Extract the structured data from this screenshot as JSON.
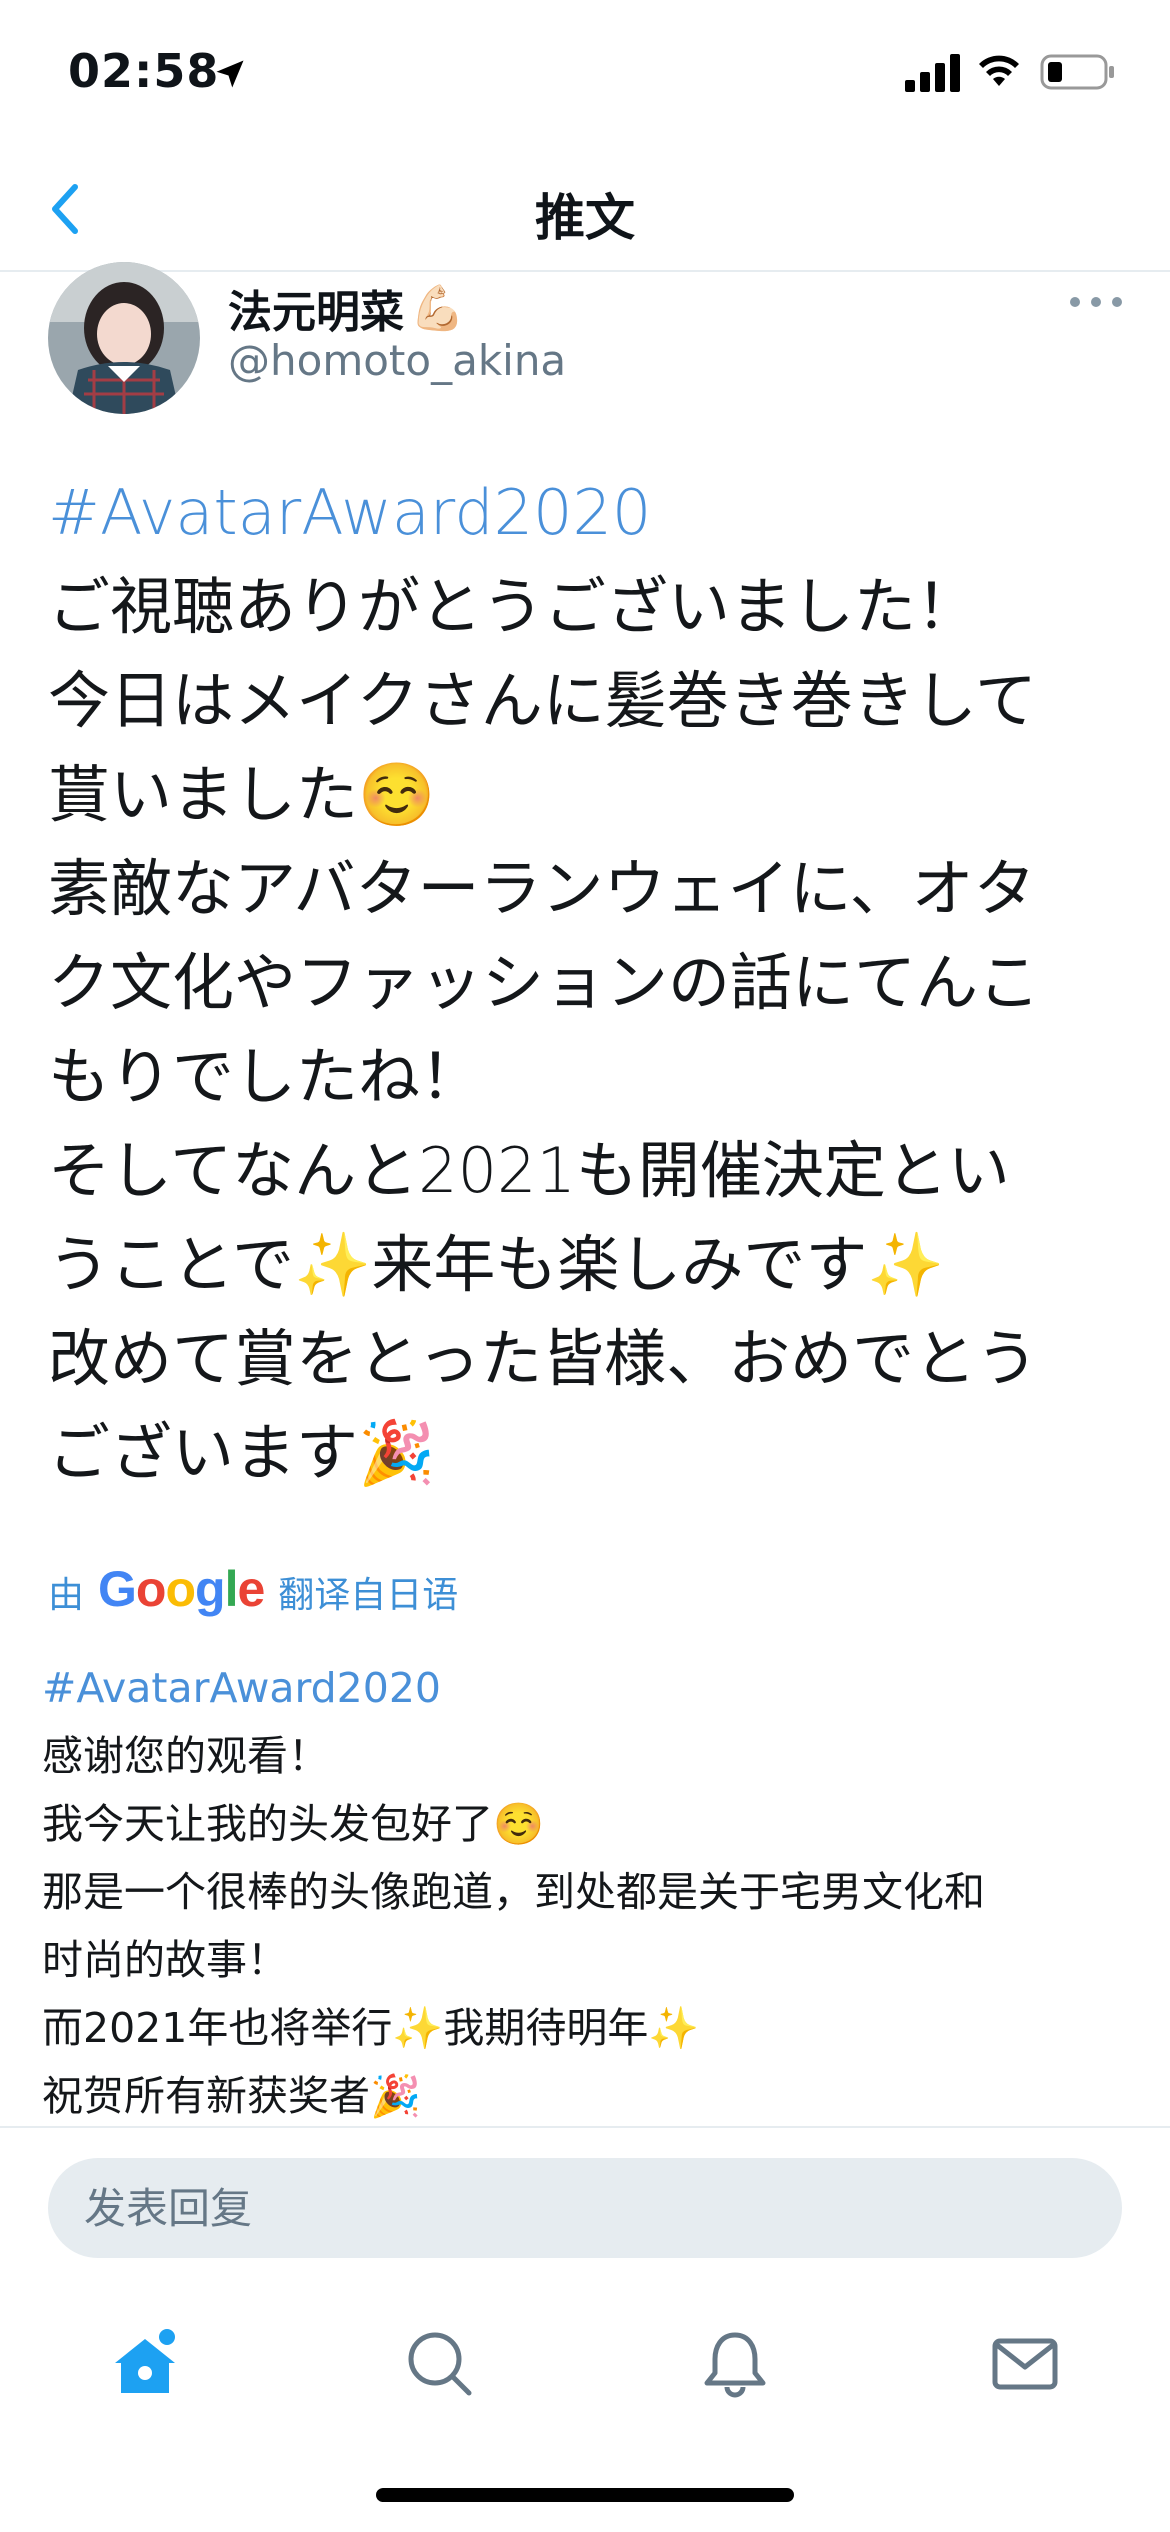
{
  "status_bar": {
    "time": "02:58",
    "icons": [
      "location-arrow-icon",
      "signal-icon",
      "wifi-icon",
      "battery-icon"
    ]
  },
  "nav": {
    "title": "推文",
    "back_icon": "chevron-left-icon"
  },
  "tweet": {
    "author_name": "法元明菜",
    "author_emoji": "💪🏻",
    "author_handle": "@homoto_akina",
    "lines": [
      "#AvatarAward2020",
      "ご視聴ありがとうございました！",
      "今日はメイクさんに髪巻き巻きして",
      "貰いました☺️",
      "素敵なアバターランウェイに、オタ",
      "ク文化やファッションの話にてんこ",
      "もりでしたね！",
      "そしてなんと2021も開催決定とい",
      "うことで✨来年も楽しみです✨",
      "改めて賞をとった皆様、おめでとう",
      "ございます🎉"
    ]
  },
  "translation": {
    "prefix": "由",
    "provider": "Google",
    "suffix": "翻译自日语",
    "lines": [
      "#AvatarAward2020",
      "感谢您的观看！",
      "我今天让我的头发包好了☺️",
      "那是一个很棒的头像跑道，到处都是关于宅男文化和",
      "时尚的故事！",
      "而2021年也将举行✨我期待明年✨",
      "祝贺所有新获奖者🎉"
    ]
  },
  "composer": {
    "placeholder": "发表回复"
  },
  "tabs": [
    {
      "name": "home",
      "icon": "home-icon"
    },
    {
      "name": "search",
      "icon": "search-icon"
    },
    {
      "name": "notifications",
      "icon": "bell-icon"
    },
    {
      "name": "messages",
      "icon": "mail-icon"
    }
  ],
  "colors": {
    "accent": "#1da1f2",
    "hashtag": "#4a90d9",
    "muted": "#657786",
    "divider": "#e6ecf0"
  }
}
